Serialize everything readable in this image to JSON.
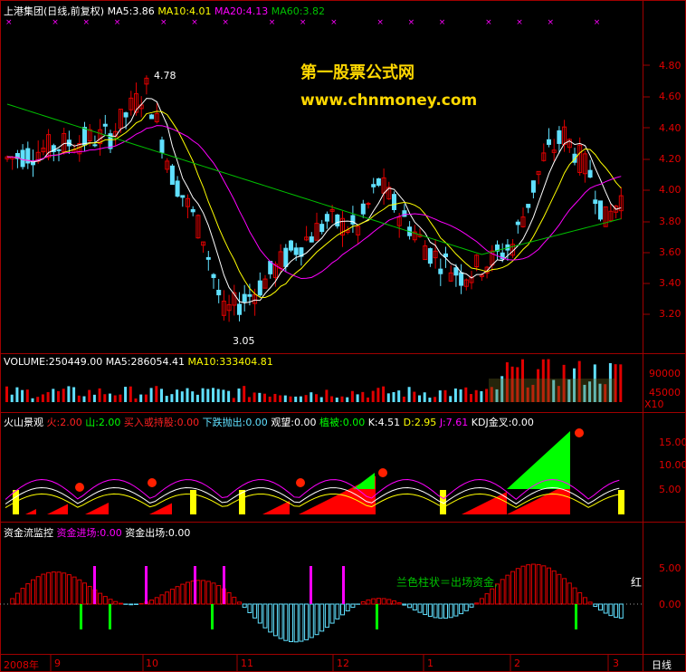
{
  "colors": {
    "up": "#e00000",
    "down": "#60e0ff",
    "ma5": "#ffffff",
    "ma10": "#ffff00",
    "ma20": "#ff00ff",
    "ma60": "#00c000",
    "axis": "#a00000"
  },
  "price_header": {
    "title": "上港集团(日线,前复权)",
    "ma5": "MA5:3.86",
    "ma10": "MA10:4.01",
    "ma20": "MA20:4.13",
    "ma60": "MA60:3.82"
  },
  "watermark": {
    "line1": "第一股票公式网",
    "line2": "www.chnmoney.com"
  },
  "annotations": {
    "high": "4.78",
    "low": "3.05"
  },
  "price_axis": [
    "4.80",
    "4.60",
    "4.40",
    "4.20",
    "4.00",
    "3.80",
    "3.60",
    "3.40",
    "3.20"
  ],
  "volume_header": {
    "volume": "VOLUME:250449.00",
    "ma5": "MA5:286054.41",
    "ma10": "MA10:333404.81"
  },
  "volume_axis": [
    "90000",
    "45000",
    "X10"
  ],
  "indicator_header": {
    "name": "火山景观",
    "fire": "火:2.00",
    "mountain": "山:2.00",
    "buy": "买入或持股:0.00",
    "sell": "下跌抛出:0.00",
    "watch": "观望:0.00",
    "plant": "植被:0.00",
    "k": "K:4.51",
    "d": "D:2.95",
    "j": "J:7.61",
    "kdj": "KDJ金叉:0.00"
  },
  "indicator_axis": [
    "15.00",
    "10.00",
    "5.00"
  ],
  "fund_header": {
    "name": "资金流监控",
    "in": "资金进场:0.00",
    "out": "资金出场:0.00"
  },
  "fund_axis": [
    "5.00",
    "0.00"
  ],
  "fund_note": "兰色柱状＝出场资金,",
  "fund_note2": "红",
  "bottom_axis": {
    "year": "2008年",
    "months": [
      "9",
      "10",
      "11",
      "12",
      "1",
      "2",
      "3"
    ],
    "period": "日线"
  },
  "chart_data": {
    "type": "candlestick",
    "x": [
      "2008-09",
      "2008-10",
      "2008-11",
      "2008-12",
      "2009-01",
      "2009-02",
      "2009-03"
    ],
    "ylim": [
      3.05,
      4.85
    ],
    "annotated_high": 4.78,
    "annotated_low": 3.05,
    "ma_last": {
      "MA5": 3.86,
      "MA10": 4.01,
      "MA20": 4.13,
      "MA60": 3.82
    },
    "volume_last": 250449.0,
    "volume_ma5": 286054.41,
    "volume_ma10": 333404.81
  }
}
